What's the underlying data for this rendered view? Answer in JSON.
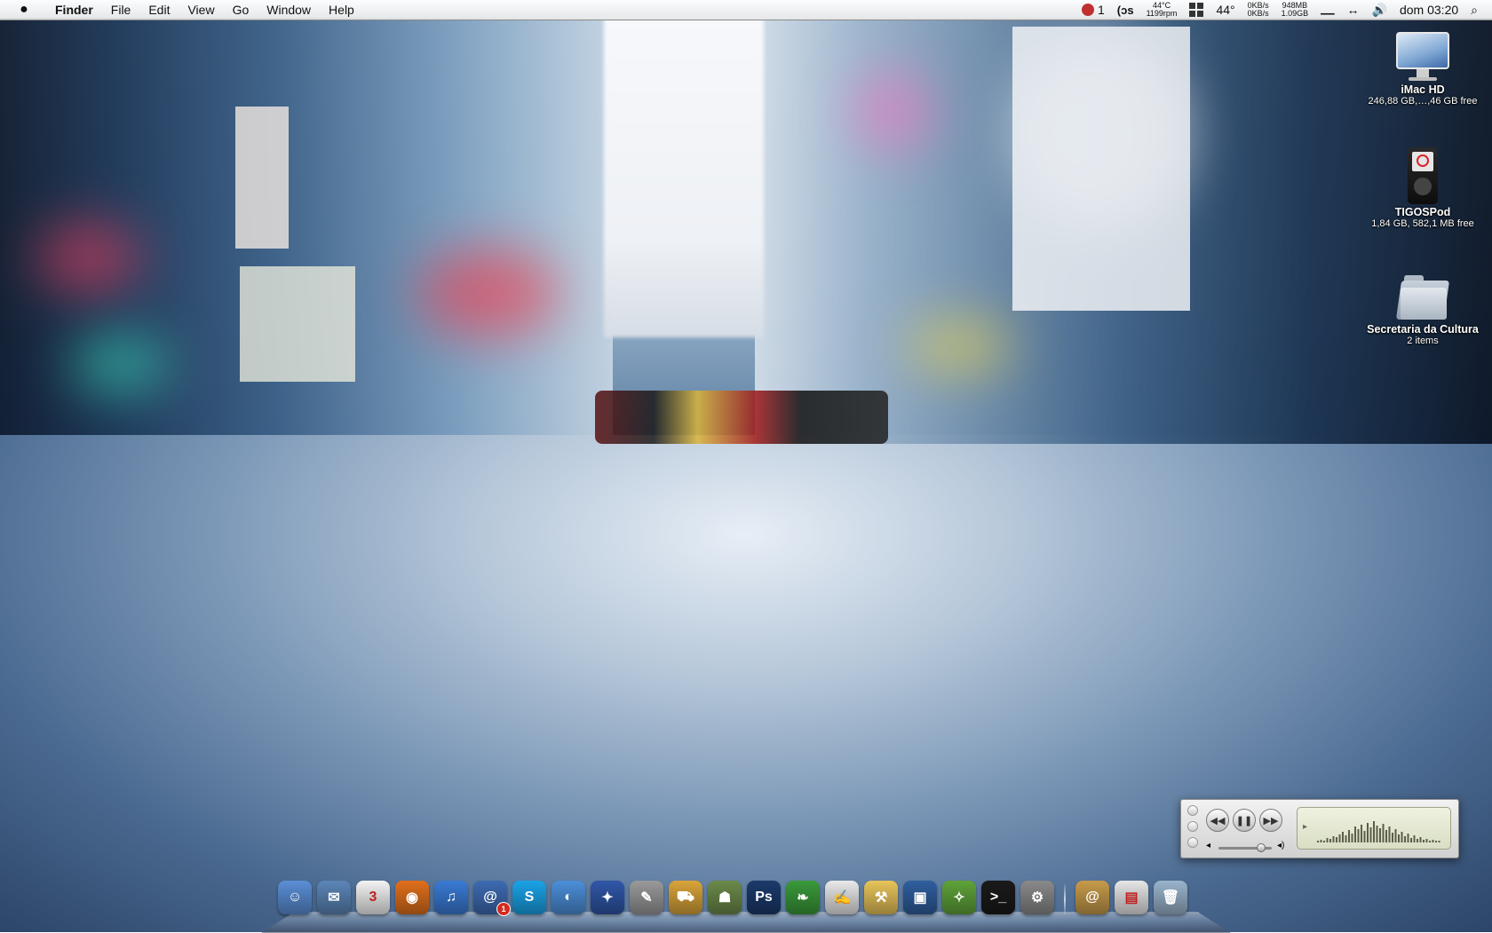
{
  "menubar": {
    "app_name": "Finder",
    "menus": [
      "File",
      "Edit",
      "View",
      "Go",
      "Window",
      "Help"
    ],
    "status": {
      "messages_count": "1",
      "cpu_temp": "44°C",
      "fan_rpm": "1199rpm",
      "weather_temp": "44°",
      "net_up": "0KB/s",
      "net_down": "0KB/s",
      "mem_used": "948MB",
      "mem_free": "1.09GB",
      "clock": "dom 03:20"
    },
    "icons": {
      "apple": "apple-icon",
      "gps": "lastfm-icon",
      "spaces": "spaces-icon",
      "sync": "sync-icon",
      "volume": "volume-icon",
      "spotlight": "spotlight-icon"
    }
  },
  "desktop": {
    "items": [
      {
        "name": "iMac HD",
        "sub": "246,88 GB,…,46 GB free"
      },
      {
        "name": "TIGOSPod",
        "sub": "1,84 GB, 582,1 MB free"
      },
      {
        "name": "Secretaria da Cultura",
        "sub": "2 items"
      }
    ]
  },
  "miniplayer": {
    "icons": [
      "rewind-icon",
      "pause-icon",
      "fast-forward-icon"
    ],
    "volume_level": 0.8
  },
  "dock": {
    "apps": [
      {
        "icon": "finder-icon",
        "color": "#5b8fd6",
        "glyph": "☺"
      },
      {
        "icon": "mail-icon",
        "color": "#5c86b8",
        "glyph": "✉"
      },
      {
        "icon": "ical-icon",
        "color": "#f4f4f4",
        "glyph": "3"
      },
      {
        "icon": "firefox-icon",
        "color": "#e0701c",
        "glyph": "◉"
      },
      {
        "icon": "itunes-icon",
        "color": "#3a7bd5",
        "glyph": "♫"
      },
      {
        "icon": "twitter-icon",
        "color": "#3e6bb3",
        "glyph": "@",
        "badge": "1"
      },
      {
        "icon": "skype-icon",
        "color": "#1aa3e8",
        "glyph": "S"
      },
      {
        "icon": "ichat-icon",
        "color": "#4c8fd9",
        "glyph": "◐"
      },
      {
        "icon": "automator-icon",
        "color": "#3057a8",
        "glyph": "✦"
      },
      {
        "icon": "script-editor-icon",
        "color": "#9a9a9a",
        "glyph": "✎"
      },
      {
        "icon": "transmit-icon",
        "color": "#d9a43a",
        "glyph": "⛟"
      },
      {
        "icon": "wishing-well-icon",
        "color": "#6c8a4a",
        "glyph": "☗"
      },
      {
        "icon": "photoshop-icon",
        "color": "#1b3a6b",
        "glyph": "Ps"
      },
      {
        "icon": "coda-icon",
        "color": "#3a9a3a",
        "glyph": "❧"
      },
      {
        "icon": "textedit-icon",
        "color": "#e9e9e9",
        "glyph": "✍"
      },
      {
        "icon": "installer-icon",
        "color": "#e8c45a",
        "glyph": "⚒"
      },
      {
        "icon": "imovie-icon",
        "color": "#2f5f9e",
        "glyph": "▣"
      },
      {
        "icon": "screenshot-icon",
        "color": "#5fa33a",
        "glyph": "✧"
      },
      {
        "icon": "terminal-icon",
        "color": "#1a1a1a",
        "glyph": ">_"
      },
      {
        "icon": "system-preferences-icon",
        "color": "#8a8a8a",
        "glyph": "⚙"
      }
    ],
    "stacks": [
      {
        "icon": "address-book-icon",
        "color": "#c79b4b",
        "glyph": "@"
      },
      {
        "icon": "downloads-stack-icon",
        "color": "#e6e6e6",
        "glyph": "▤"
      },
      {
        "icon": "trash-icon",
        "color": "#9ab4cc",
        "glyph": "🗑"
      }
    ]
  }
}
